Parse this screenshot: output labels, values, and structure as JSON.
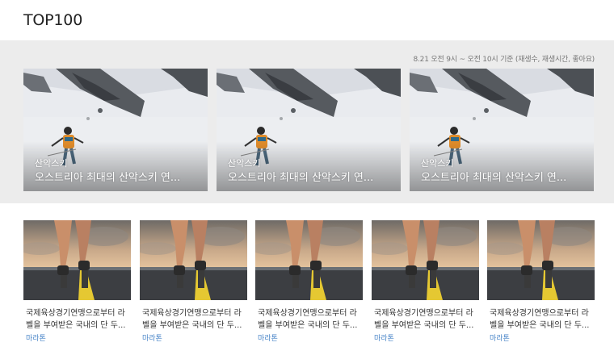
{
  "page": {
    "title": "TOP100"
  },
  "ranking": {
    "basis_text": "8.21 오전 9시 ~ 오전 10시 기준 (재생수, 재생시간, 좋아요)",
    "featured": [
      {
        "category": "산악스키",
        "title": "오스트리아 최대의 산악스키 연...",
        "image_icon": "skier-photo"
      },
      {
        "category": "산악스키",
        "title": "오스트리아 최대의 산악스키 연...",
        "image_icon": "skier-photo"
      },
      {
        "category": "산악스키",
        "title": "오스트리아 최대의 산악스키 연...",
        "image_icon": "skier-photo"
      }
    ],
    "list": [
      {
        "title_line1": "국제육상경기연맹으로부터 라",
        "title_line2": "벨을 부여받은 국내의 단 두...",
        "category": "마라톤",
        "image_icon": "runner-photo"
      },
      {
        "title_line1": "국제육상경기연맹으로부터 라",
        "title_line2": "벨을 부여받은 국내의 단 두...",
        "category": "마라톤",
        "image_icon": "runner-photo"
      },
      {
        "title_line1": "국제육상경기연맹으로부터 라",
        "title_line2": "벨을 부여받은 국내의 단 두...",
        "category": "마라톤",
        "image_icon": "runner-photo"
      },
      {
        "title_line1": "국제육상경기연맹으로부터 라",
        "title_line2": "벨을 부여받은 국내의 단 두...",
        "category": "마라톤",
        "image_icon": "runner-photo"
      },
      {
        "title_line1": "국제육상경기연맹으로부터 라",
        "title_line2": "벨을 부여받은 국내의 단 두...",
        "category": "마라톤",
        "image_icon": "runner-photo"
      }
    ]
  },
  "colors": {
    "band_bg": "#ececec",
    "category_link": "#4a86c8",
    "title_text": "#222222"
  }
}
